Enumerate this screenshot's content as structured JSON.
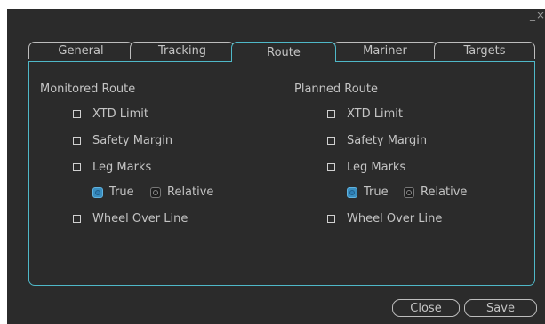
{
  "window": {
    "minimize_glyph": "_",
    "close_glyph": "×"
  },
  "tabs": [
    {
      "label": "General"
    },
    {
      "label": "Tracking"
    },
    {
      "label": "Route"
    },
    {
      "label": "Mariner"
    },
    {
      "label": "Targets"
    }
  ],
  "active_tab": "Route",
  "monitored": {
    "title": "Monitored Route",
    "xtd": "XTD Limit",
    "safety": "Safety Margin",
    "leg": "Leg Marks",
    "true": "True",
    "relative": "Relative",
    "wheel": "Wheel Over Line",
    "leg_marks_mode": "True"
  },
  "planned": {
    "title": "Planned Route",
    "xtd": "XTD Limit",
    "safety": "Safety Margin",
    "leg": "Leg Marks",
    "true": "True",
    "relative": "Relative",
    "wheel": "Wheel Over Line",
    "leg_marks_mode": "True"
  },
  "buttons": {
    "close": "Close",
    "save": "Save"
  },
  "colors": {
    "background": "#2b2b2b",
    "accent": "#4fb8c8",
    "radio_selected": "#3a8ec0"
  }
}
